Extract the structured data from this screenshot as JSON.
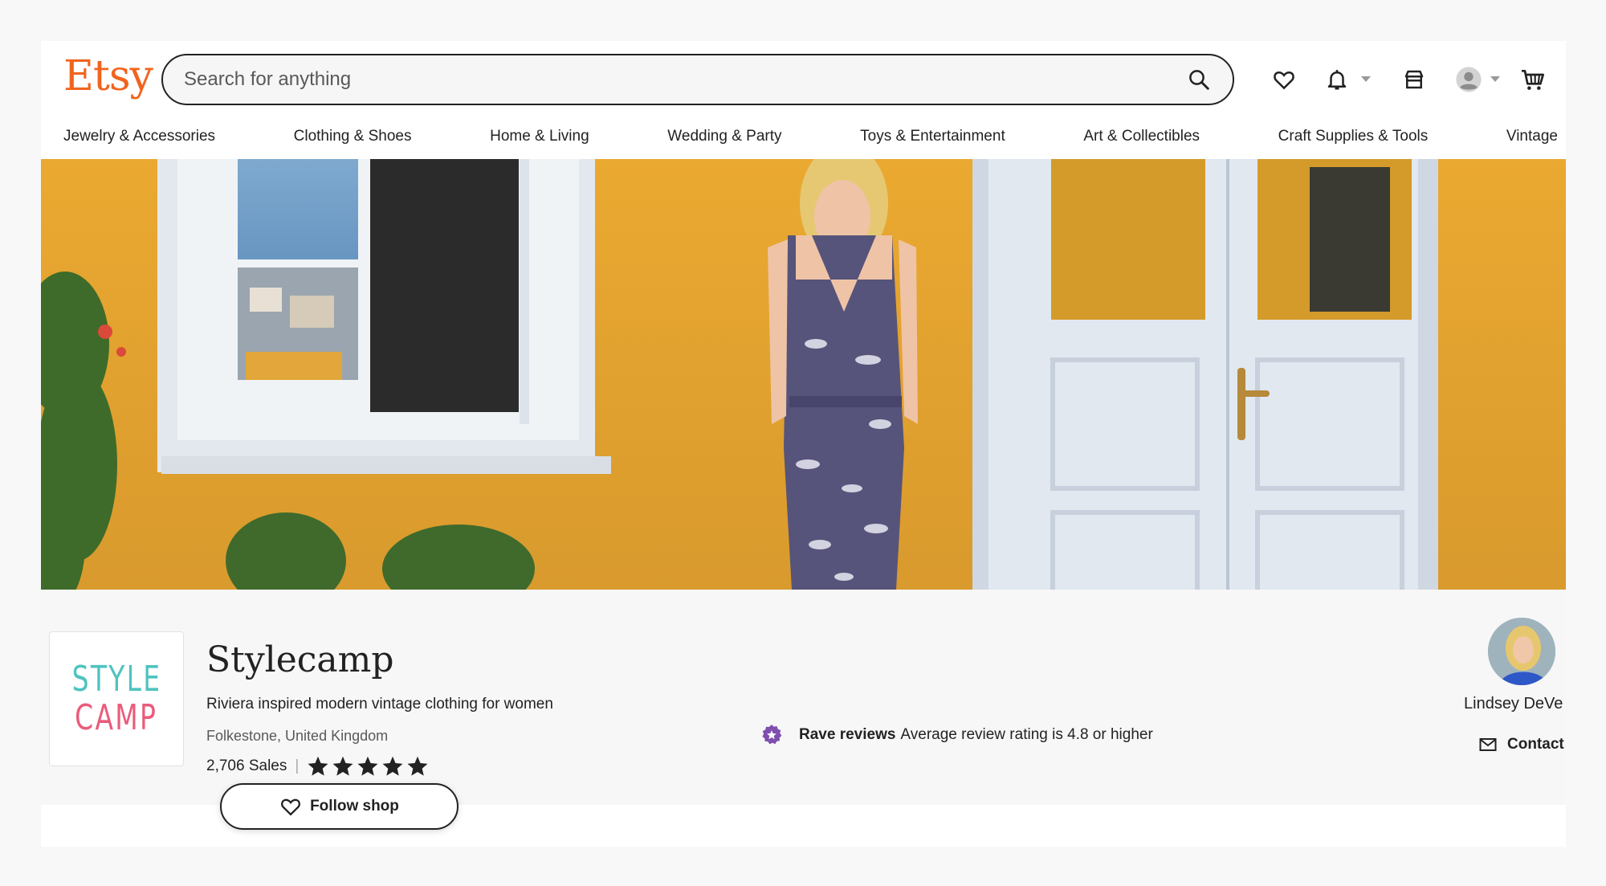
{
  "header": {
    "logo": "Etsy",
    "search_placeholder": "Search for anything"
  },
  "nav": [
    "Jewelry & Accessories",
    "Clothing & Shoes",
    "Home & Living",
    "Wedding & Party",
    "Toys & Entertainment",
    "Art & Collectibles",
    "Craft Supplies & Tools",
    "Vintage"
  ],
  "shop": {
    "logo_line1": "STYLE",
    "logo_line2": "CAMP",
    "name": "Stylecamp",
    "tagline": "Riviera inspired modern vintage clothing for women",
    "location": "Folkestone, United Kingdom",
    "sales": "2,706 Sales",
    "rating_stars": 5,
    "follow_label": "Follow shop"
  },
  "rave": {
    "title": "Rave reviews",
    "text": "Average review rating is 4.8 or higher"
  },
  "owner": {
    "name": "Lindsey DeVe",
    "contact_label": "Contact"
  },
  "colors": {
    "brand": "#f1641e",
    "rave_badge": "#7f4fb0",
    "wall": "#e9a933",
    "logo_teal": "#4fc3c0",
    "logo_pink": "#ea5b7a"
  }
}
